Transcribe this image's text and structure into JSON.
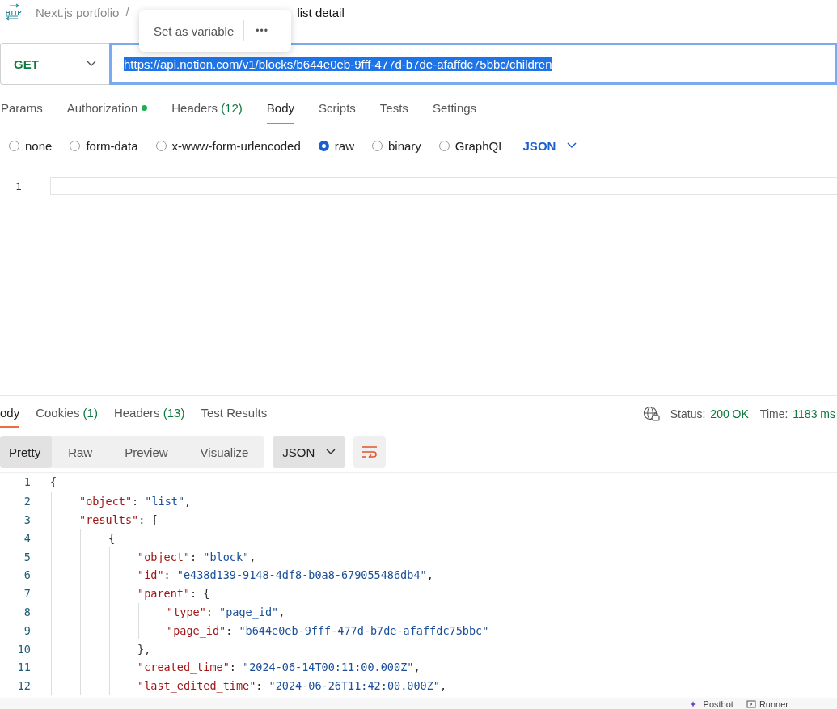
{
  "breadcrumb": {
    "icon_label": "HTTP",
    "collection": "Next.js portfolio",
    "separator": "/",
    "request": "list detail"
  },
  "popup": {
    "action": "Set as variable",
    "more": "•••"
  },
  "request": {
    "method": "GET",
    "url": "https://api.notion.com/v1/blocks/b644e0eb-9fff-477d-b7de-afaffdc75bbc/children",
    "url_selected": true
  },
  "tabs": [
    {
      "label": "Params",
      "selected": false
    },
    {
      "label": "Authorization",
      "selected": false,
      "dot": true
    },
    {
      "label": "Headers",
      "count": "(12)",
      "selected": false
    },
    {
      "label": "Body",
      "selected": true
    },
    {
      "label": "Scripts",
      "selected": false
    },
    {
      "label": "Tests",
      "selected": false
    },
    {
      "label": "Settings",
      "selected": false
    }
  ],
  "body_types": [
    {
      "label": "none",
      "selected": false
    },
    {
      "label": "form-data",
      "selected": false
    },
    {
      "label": "x-www-form-urlencoded",
      "selected": false
    },
    {
      "label": "raw",
      "selected": true
    },
    {
      "label": "binary",
      "selected": false
    },
    {
      "label": "GraphQL",
      "selected": false
    }
  ],
  "raw_format": "JSON",
  "body_editor": {
    "line_numbers": [
      "1"
    ]
  },
  "response_tabs": [
    {
      "label": "ody",
      "selected": true
    },
    {
      "label": "Cookies",
      "count": "(1)",
      "selected": false
    },
    {
      "label": "Headers",
      "count": "(13)",
      "selected": false
    },
    {
      "label": "Test Results",
      "selected": false
    }
  ],
  "status": {
    "status_label": "Status:",
    "status_value": "200 OK",
    "time_label": "Time:",
    "time_value": "1183 ms"
  },
  "view_modes": [
    {
      "label": "Pretty",
      "selected": true
    },
    {
      "label": "Raw",
      "selected": false
    },
    {
      "label": "Preview",
      "selected": false
    },
    {
      "label": "Visualize",
      "selected": false
    }
  ],
  "response_format": "JSON",
  "code": [
    {
      "number": "1",
      "segments": [
        {
          "kind": "punct",
          "text": "{"
        }
      ],
      "children": [
        {
          "number": "2",
          "segments": [
            {
              "kind": "key",
              "text": "\"object\""
            },
            {
              "kind": "punct",
              "text": ": "
            },
            {
              "kind": "str",
              "text": "\"list\""
            },
            {
              "kind": "punct",
              "text": ","
            }
          ]
        },
        {
          "number": "3",
          "segments": [
            {
              "kind": "key",
              "text": "\"results\""
            },
            {
              "kind": "punct",
              "text": ": ["
            }
          ],
          "children": [
            {
              "number": "4",
              "segments": [
                {
                  "kind": "punct",
                  "text": "{"
                }
              ],
              "children": [
                {
                  "number": "5",
                  "segments": [
                    {
                      "kind": "key",
                      "text": "\"object\""
                    },
                    {
                      "kind": "punct",
                      "text": ": "
                    },
                    {
                      "kind": "str",
                      "text": "\"block\""
                    },
                    {
                      "kind": "punct",
                      "text": ","
                    }
                  ]
                },
                {
                  "number": "6",
                  "segments": [
                    {
                      "kind": "key",
                      "text": "\"id\""
                    },
                    {
                      "kind": "punct",
                      "text": ": "
                    },
                    {
                      "kind": "str",
                      "text": "\"e438d139-9148-4df8-b0a8-679055486db4\""
                    },
                    {
                      "kind": "punct",
                      "text": ","
                    }
                  ]
                },
                {
                  "number": "7",
                  "segments": [
                    {
                      "kind": "key",
                      "text": "\"parent\""
                    },
                    {
                      "kind": "punct",
                      "text": ": {"
                    }
                  ],
                  "children": [
                    {
                      "number": "8",
                      "segments": [
                        {
                          "kind": "key",
                          "text": "\"type\""
                        },
                        {
                          "kind": "punct",
                          "text": ": "
                        },
                        {
                          "kind": "str",
                          "text": "\"page_id\""
                        },
                        {
                          "kind": "punct",
                          "text": ","
                        }
                      ]
                    },
                    {
                      "number": "9",
                      "segments": [
                        {
                          "kind": "key",
                          "text": "\"page_id\""
                        },
                        {
                          "kind": "punct",
                          "text": ": "
                        },
                        {
                          "kind": "str",
                          "text": "\"b644e0eb-9fff-477d-b7de-afaffdc75bbc\""
                        }
                      ]
                    }
                  ]
                },
                {
                  "number": "10",
                  "segments": [
                    {
                      "kind": "punct",
                      "text": "},"
                    }
                  ]
                },
                {
                  "number": "11",
                  "segments": [
                    {
                      "kind": "key",
                      "text": "\"created_time\""
                    },
                    {
                      "kind": "punct",
                      "text": ": "
                    },
                    {
                      "kind": "str",
                      "text": "\"2024-06-14T00:11:00.000Z\""
                    },
                    {
                      "kind": "punct",
                      "text": ","
                    }
                  ]
                },
                {
                  "number": "12",
                  "segments": [
                    {
                      "kind": "key",
                      "text": "\"last_edited_time\""
                    },
                    {
                      "kind": "punct",
                      "text": ": "
                    },
                    {
                      "kind": "str",
                      "text": "\"2024-06-26T11:42:00.000Z\""
                    },
                    {
                      "kind": "punct",
                      "text": ","
                    }
                  ]
                }
              ]
            }
          ]
        }
      ]
    }
  ],
  "footer": [
    {
      "label": "Postbot",
      "kind": "postbot"
    },
    {
      "label": "Runner",
      "kind": "runner"
    }
  ]
}
